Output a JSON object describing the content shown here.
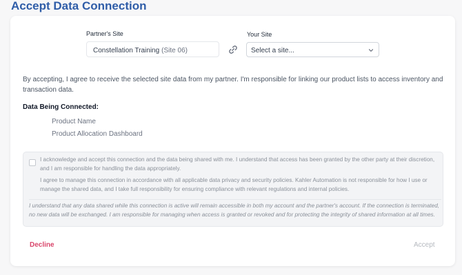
{
  "page": {
    "title": "Accept Data Connection"
  },
  "connection": {
    "partner_label": "Partner's Site",
    "partner_site_name": "Constellation Training",
    "partner_site_id": "(Site 06)",
    "your_label": "Your Site",
    "your_site_placeholder": "Select a site...",
    "link_icon": "link-icon",
    "dropdown_icon": "chevron-down-icon"
  },
  "intro_text": "By accepting, I agree to receive the selected site data from my partner. I'm responsible for linking our product lists to access inventory and transaction data.",
  "data_section": {
    "heading": "Data Being Connected:",
    "items": [
      "Product Name",
      "Product Allocation Dashboard"
    ]
  },
  "acknowledgement": {
    "checked": false,
    "paragraph_1": "I acknowledge and accept this connection and the data being shared with me. I understand that access has been granted by the other party at their discretion, and I am responsible for handling the data appropriately.",
    "paragraph_2": "I agree to manage this connection in accordance with all applicable data privacy and security policies. Kahler Automation is not responsible for how I use or manage the shared data, and I take full responsibility for ensuring compliance with relevant regulations and internal policies.",
    "note": "I understand that any data shared while this connection is active will remain accessible in both my account and the partner's account. If the connection is terminated, no new data will be exchanged. I am responsible for managing when access is granted or revoked and for protecting the integrity of shared information at all times."
  },
  "actions": {
    "decline_label": "Decline",
    "accept_label": "Accept"
  },
  "colors": {
    "title": "#2f5da8",
    "decline": "#d9466b",
    "accept_disabled": "#b5b9bf"
  }
}
